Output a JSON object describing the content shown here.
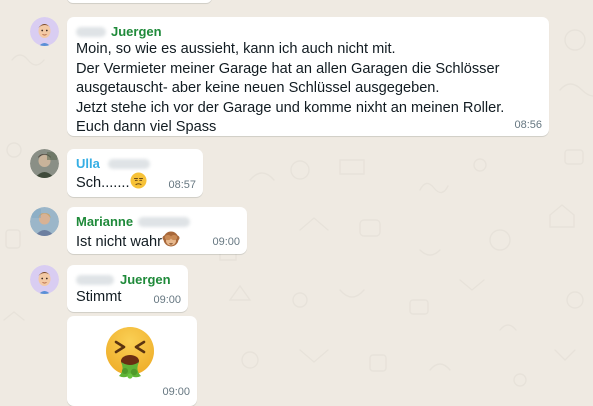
{
  "messages": [
    {
      "sender": "Juergen",
      "sender_color": "#1f8a3a",
      "lines": [
        "Moin, so wie es aussieht, kann ich auch nicht mit.",
        "Der Vermieter meiner Garage hat an allen Garagen die Schlösser",
        "ausgetauscht- aber keine neuen Schlüssel ausgegeben.",
        "Jetzt stehe ich vor der Garage und komme nixht an meinen Roller.",
        "Euch dann viel Spass"
      ],
      "time": "08:56"
    },
    {
      "sender": "Ulla",
      "sender_color": "#35aee4",
      "text": "Sch.......",
      "emoji": "unamused-face-icon",
      "time": "08:57"
    },
    {
      "sender": "Marianne",
      "sender_color": "#1f8a3a",
      "text": "Ist nicht wahr",
      "emoji": "see-no-evil-monkey-icon",
      "time": "09:00"
    },
    {
      "sender": "Juergen",
      "sender_color": "#1f8a3a",
      "text": "Stimmt",
      "time": "09:00"
    },
    {
      "sticker": "vomiting-face-icon",
      "time": "09:00"
    }
  ],
  "colors": {
    "background": "#efeae2",
    "bubble": "#ffffff",
    "timestamp": "#667781"
  }
}
